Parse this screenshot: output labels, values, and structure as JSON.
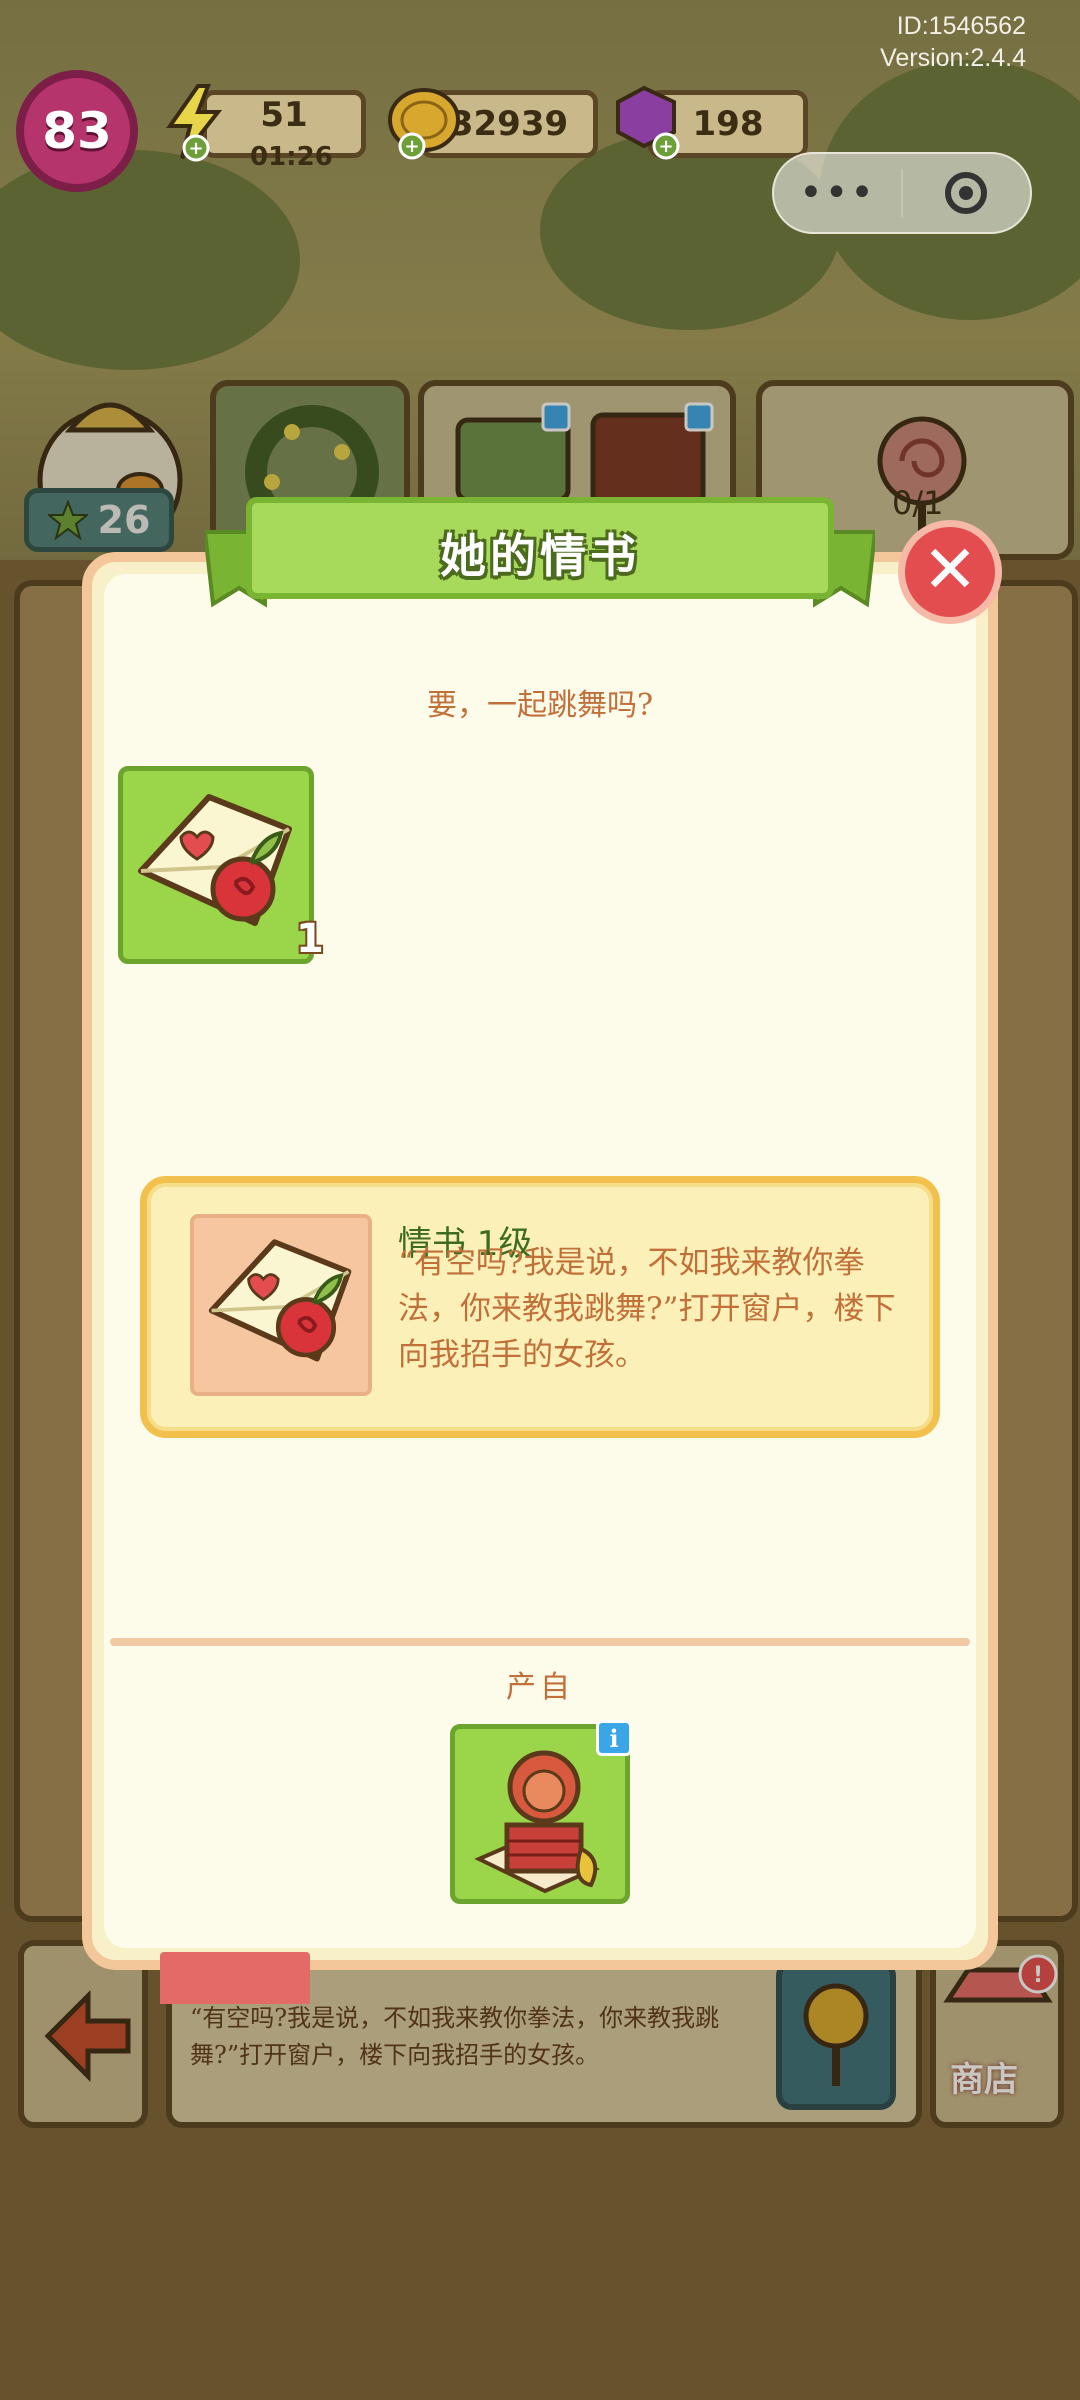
{
  "hud": {
    "id_text": "ID:1546562",
    "version_text": "Version:2.4.4",
    "level": "83",
    "energy": "51",
    "energy_timer": "01:26",
    "coins": "32939",
    "gems": "198",
    "stars": "26",
    "quest_progress": "0/1"
  },
  "miniprogram_capsule": {
    "more_icon": "more-dots-icon",
    "close_icon": "target-close-icon"
  },
  "modal": {
    "title": "她的情书",
    "subtitle": "要，一起跳舞吗?",
    "item_count": "1",
    "info_title": "情书  1级",
    "info_desc": "“有空吗?我是说，不如我来教你拳法，你来教我跳舞?”打开窗户，楼下向我招手的女孩。",
    "source_label": "产自"
  },
  "behind": {
    "description": "“有空吗?我是说，不如我来教你拳法，你来教我跳舞?”打开窗户，楼下向我招手的女孩。",
    "shop_label": "商店"
  },
  "colors": {
    "accent_green": "#9bd64a",
    "close_red": "#e34d4f",
    "text_orange": "#c2703a",
    "title_green": "#3d6b1f"
  }
}
